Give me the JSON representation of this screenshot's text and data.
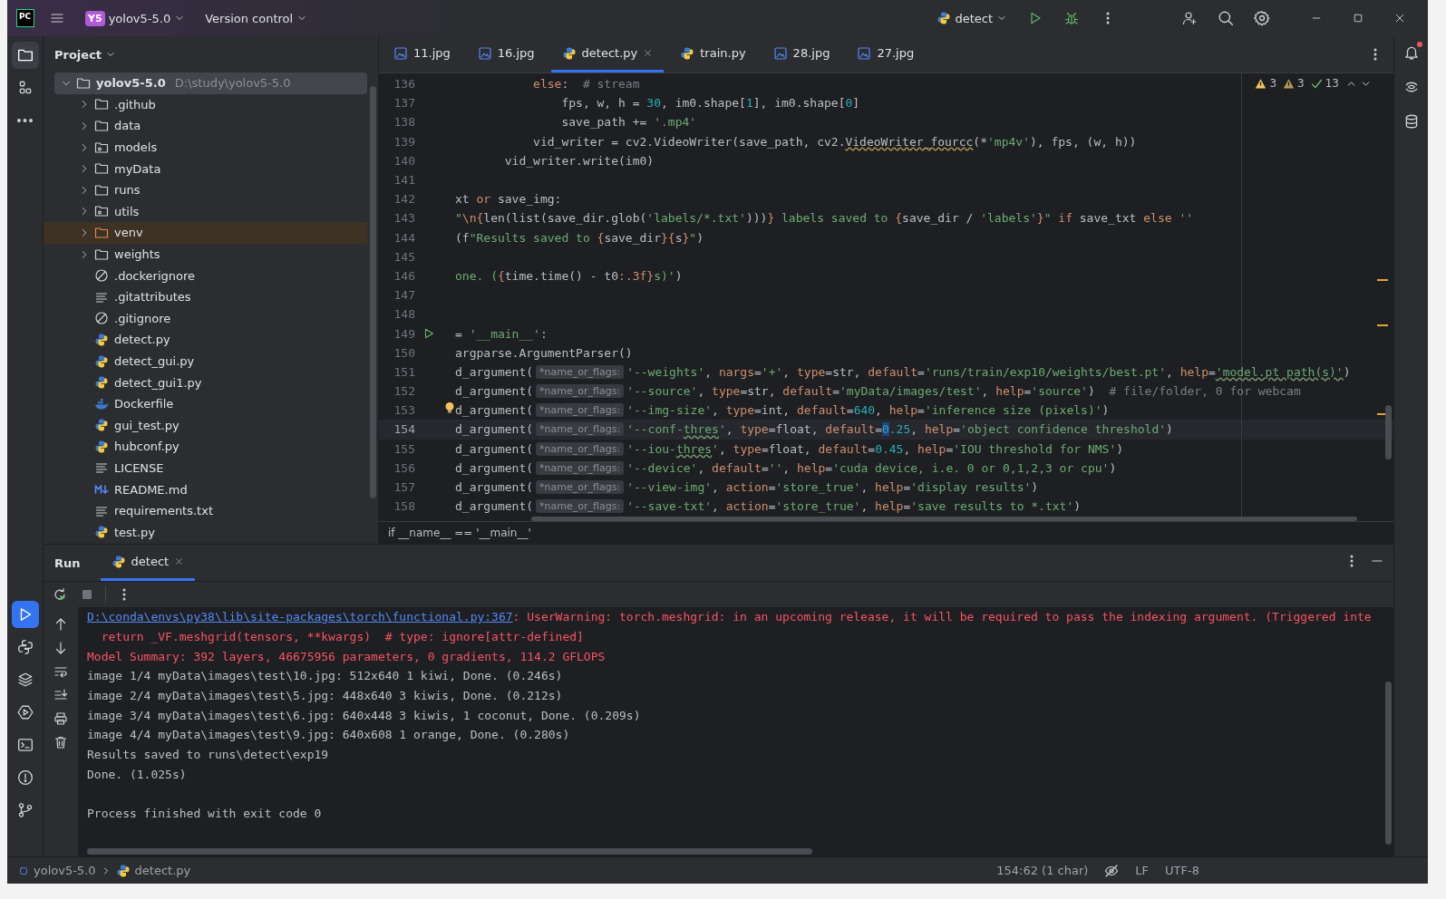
{
  "title_bar": {
    "app_icon": "PC",
    "project_badge": "Y5",
    "project": "yolov5-5.0",
    "vcs": "Version control",
    "run_config": "detect"
  },
  "left_strip": {
    "top": [
      {
        "kind": "project",
        "selected": true
      },
      {
        "kind": "structure",
        "selected": false
      },
      {
        "kind": "more",
        "selected": false
      }
    ],
    "bottom": [
      {
        "kind": "run",
        "selected": true
      },
      {
        "kind": "python-console",
        "selected": false
      },
      {
        "kind": "layers",
        "selected": false
      },
      {
        "kind": "services",
        "selected": false
      },
      {
        "kind": "terminal",
        "selected": false
      },
      {
        "kind": "problems",
        "selected": false
      },
      {
        "kind": "git",
        "selected": false
      }
    ]
  },
  "project_panel": {
    "title": "Project",
    "root": {
      "name": "yolov5-5.0",
      "path": "D:\\study\\yolov5-5.0",
      "expanded": true,
      "selected": true,
      "children": [
        {
          "name": ".github",
          "kind": "folder",
          "expanded": false,
          "excluded": false
        },
        {
          "name": "data",
          "kind": "folder",
          "expanded": false,
          "excluded": false
        },
        {
          "name": "models",
          "kind": "package",
          "expanded": false,
          "excluded": false
        },
        {
          "name": "myData",
          "kind": "folder",
          "expanded": false,
          "excluded": false
        },
        {
          "name": "runs",
          "kind": "folder",
          "expanded": false,
          "excluded": false
        },
        {
          "name": "utils",
          "kind": "package",
          "expanded": false,
          "excluded": false
        },
        {
          "name": "venv",
          "kind": "folder",
          "expanded": false,
          "excluded": true
        },
        {
          "name": "weights",
          "kind": "folder",
          "expanded": false,
          "excluded": false
        },
        {
          "name": ".dockerignore",
          "kind": "ignore",
          "excluded": false
        },
        {
          "name": ".gitattributes",
          "kind": "text",
          "excluded": false
        },
        {
          "name": ".gitignore",
          "kind": "ignore",
          "excluded": false
        },
        {
          "name": "detect.py",
          "kind": "python",
          "excluded": false
        },
        {
          "name": "detect_gui.py",
          "kind": "python",
          "excluded": false
        },
        {
          "name": "detect_gui1.py",
          "kind": "python",
          "excluded": false
        },
        {
          "name": "Dockerfile",
          "kind": "docker",
          "excluded": false
        },
        {
          "name": "gui_test.py",
          "kind": "python",
          "excluded": false
        },
        {
          "name": "hubconf.py",
          "kind": "python",
          "excluded": false
        },
        {
          "name": "LICENSE",
          "kind": "text",
          "excluded": false
        },
        {
          "name": "README.md",
          "kind": "markdown",
          "excluded": false
        },
        {
          "name": "requirements.txt",
          "kind": "text",
          "excluded": false
        },
        {
          "name": "test.py",
          "kind": "python",
          "excluded": false
        }
      ]
    }
  },
  "editor": {
    "tabs": [
      {
        "label": "11.jpg",
        "kind": "image",
        "selected": false,
        "closable": false
      },
      {
        "label": "16.jpg",
        "kind": "image",
        "selected": false,
        "closable": false
      },
      {
        "label": "detect.py",
        "kind": "python",
        "selected": true,
        "closable": true
      },
      {
        "label": "train.py",
        "kind": "python",
        "selected": false,
        "closable": false
      },
      {
        "label": "28.jpg",
        "kind": "image",
        "selected": false,
        "closable": false
      },
      {
        "label": "27.jpg",
        "kind": "image",
        "selected": false,
        "closable": false
      }
    ],
    "inspections": [
      {
        "kind": "warning",
        "count": "3"
      },
      {
        "kind": "weak-warning",
        "count": "3"
      },
      {
        "kind": "ok",
        "count": "13"
      }
    ],
    "lines": [
      {
        "number": "136",
        "current": false,
        "tokens": [
          {
            "t": "           else",
            "kind": "kw"
          },
          {
            "t": ":  ",
            "kind": "plain"
          },
          {
            "t": "# stream",
            "kind": "comment"
          }
        ]
      },
      {
        "number": "137",
        "current": false,
        "tokens": [
          {
            "t": "               fps, w, h = ",
            "kind": "plain"
          },
          {
            "t": "30",
            "kind": "num"
          },
          {
            "t": ", im0.shape[",
            "kind": "plain"
          },
          {
            "t": "1",
            "kind": "num"
          },
          {
            "t": "], im0.shape[",
            "kind": "plain"
          },
          {
            "t": "0",
            "kind": "num"
          },
          {
            "t": "]",
            "kind": "plain"
          }
        ]
      },
      {
        "number": "138",
        "current": false,
        "tokens": [
          {
            "t": "               save_path += ",
            "kind": "plain"
          },
          {
            "t": "'.mp4'",
            "kind": "str"
          }
        ]
      },
      {
        "number": "139",
        "current": false,
        "tokens": [
          {
            "t": "           vid_writer = cv2.VideoWriter(save_path, cv2.",
            "kind": "plain"
          },
          {
            "t": "VideoWriter_fourcc",
            "kind": "warn"
          },
          {
            "t": "(*",
            "kind": "plain"
          },
          {
            "t": "'mp4v'",
            "kind": "str"
          },
          {
            "t": "), fps, (w, h))",
            "kind": "plain"
          }
        ]
      },
      {
        "number": "140",
        "current": false,
        "tokens": [
          {
            "t": "       vid_writer.write(im0)",
            "kind": "plain"
          }
        ]
      },
      {
        "number": "141",
        "current": false
      },
      {
        "number": "142",
        "current": false,
        "tokens": [
          {
            "t": "xt ",
            "kind": "plain"
          },
          {
            "t": "or",
            "kind": "kw"
          },
          {
            "t": " save_img:",
            "kind": "plain"
          }
        ]
      },
      {
        "number": "143",
        "current": false,
        "tokens": [
          {
            "t": "\"",
            "kind": "str"
          },
          {
            "t": "\\n{",
            "kind": "kw"
          },
          {
            "t": "len(list(save_dir.glob(",
            "kind": "plain"
          },
          {
            "t": "'labels/*.txt'",
            "kind": "str"
          },
          {
            "t": ")))",
            "kind": "plain"
          },
          {
            "t": "}",
            "kind": "kw"
          },
          {
            "t": " labels saved to ",
            "kind": "str"
          },
          {
            "t": "{",
            "kind": "kw"
          },
          {
            "t": "save_dir / ",
            "kind": "plain"
          },
          {
            "t": "'labels'",
            "kind": "str"
          },
          {
            "t": "}",
            "kind": "kw"
          },
          {
            "t": "\"",
            "kind": "str"
          },
          {
            "t": " if",
            "kind": "kw"
          },
          {
            "t": " save_txt ",
            "kind": "plain"
          },
          {
            "t": "else",
            "kind": "kw"
          },
          {
            "t": " ''",
            "kind": "str"
          }
        ]
      },
      {
        "number": "144",
        "current": false,
        "tokens": [
          {
            "t": "(f",
            "kind": "plain"
          },
          {
            "t": "\"Results saved to ",
            "kind": "str"
          },
          {
            "t": "{",
            "kind": "kw"
          },
          {
            "t": "save_dir",
            "kind": "plain"
          },
          {
            "t": "}{",
            "kind": "kw"
          },
          {
            "t": "s",
            "kind": "plain"
          },
          {
            "t": "}",
            "kind": "kw"
          },
          {
            "t": "\"",
            "kind": "str"
          },
          {
            "t": ")",
            "kind": "plain"
          }
        ]
      },
      {
        "number": "145",
        "current": false
      },
      {
        "number": "146",
        "current": false,
        "tokens": [
          {
            "t": "one. (",
            "kind": "str"
          },
          {
            "t": "{",
            "kind": "kw"
          },
          {
            "t": "time.time() - t0",
            "kind": "plain"
          },
          {
            "t": ":.3f",
            "kind": "kw"
          },
          {
            "t": "}",
            "kind": "kw"
          },
          {
            "t": "s)'",
            "kind": "str"
          },
          {
            "t": ")",
            "kind": "plain"
          }
        ]
      },
      {
        "number": "147",
        "current": false
      },
      {
        "number": "148",
        "current": false
      },
      {
        "number": "149",
        "current": false,
        "marker": {
          "kind": "run"
        },
        "tokens": [
          {
            "t": "= ",
            "kind": "plain"
          },
          {
            "t": "'__main__'",
            "kind": "str"
          },
          {
            "t": ":",
            "kind": "plain"
          }
        ]
      },
      {
        "number": "150",
        "current": false,
        "tokens": [
          {
            "t": "argparse.ArgumentParser()",
            "kind": "plain"
          }
        ]
      },
      {
        "number": "151",
        "current": false,
        "tokens": [
          {
            "t": "d_argument(",
            "kind": "plain"
          },
          {
            "t": "*name_or_flags:",
            "kind": "hint"
          },
          {
            "t": "'--weights'",
            "kind": "str"
          },
          {
            "t": ", ",
            "kind": "plain"
          },
          {
            "t": "nargs",
            "kind": "kw"
          },
          {
            "t": "=",
            "kind": "plain"
          },
          {
            "t": "'+'",
            "kind": "str"
          },
          {
            "t": ", ",
            "kind": "plain"
          },
          {
            "t": "type",
            "kind": "kw"
          },
          {
            "t": "=str, ",
            "kind": "plain"
          },
          {
            "t": "default",
            "kind": "kw"
          },
          {
            "t": "=",
            "kind": "plain"
          },
          {
            "t": "'runs/train/exp10/weights/best.pt'",
            "kind": "str"
          },
          {
            "t": ", ",
            "kind": "plain"
          },
          {
            "t": "help",
            "kind": "kw"
          },
          {
            "t": "=",
            "kind": "plain"
          },
          {
            "t": "'model.pt path(s)'",
            "kind": "typo"
          },
          {
            "t": ")",
            "kind": "plain"
          }
        ]
      },
      {
        "number": "152",
        "current": false,
        "tokens": [
          {
            "t": "d_argument(",
            "kind": "plain"
          },
          {
            "t": "*name_or_flags:",
            "kind": "hint"
          },
          {
            "t": "'--source'",
            "kind": "str"
          },
          {
            "t": ", ",
            "kind": "plain"
          },
          {
            "t": "type",
            "kind": "kw"
          },
          {
            "t": "=str, ",
            "kind": "plain"
          },
          {
            "t": "default",
            "kind": "kw"
          },
          {
            "t": "=",
            "kind": "plain"
          },
          {
            "t": "'myData/images/test'",
            "kind": "str"
          },
          {
            "t": ", ",
            "kind": "plain"
          },
          {
            "t": "help",
            "kind": "kw"
          },
          {
            "t": "=",
            "kind": "plain"
          },
          {
            "t": "'source'",
            "kind": "str"
          },
          {
            "t": ")  ",
            "kind": "plain"
          },
          {
            "t": "# file/folder, 0 for webcam",
            "kind": "comment"
          }
        ]
      },
      {
        "number": "153",
        "current": false,
        "marker": {
          "kind": "bulb"
        },
        "tokens": [
          {
            "t": "d_argument(",
            "kind": "plain"
          },
          {
            "t": "*name_or_flags:",
            "kind": "hint"
          },
          {
            "t": "'--img-size'",
            "kind": "str"
          },
          {
            "t": ", ",
            "kind": "plain"
          },
          {
            "t": "type",
            "kind": "kw"
          },
          {
            "t": "=int, ",
            "kind": "plain"
          },
          {
            "t": "default",
            "kind": "kw"
          },
          {
            "t": "=",
            "kind": "plain"
          },
          {
            "t": "640",
            "kind": "num"
          },
          {
            "t": ", ",
            "kind": "plain"
          },
          {
            "t": "help",
            "kind": "kw"
          },
          {
            "t": "=",
            "kind": "plain"
          },
          {
            "t": "'inference size (pixels)'",
            "kind": "str"
          },
          {
            "t": ")",
            "kind": "plain"
          }
        ]
      },
      {
        "number": "154",
        "current": true,
        "tokens": [
          {
            "t": "d_argument(",
            "kind": "plain"
          },
          {
            "t": "*name_or_flags:",
            "kind": "hint"
          },
          {
            "t": "'--conf-",
            "kind": "str"
          },
          {
            "t": "thres",
            "kind": "typo"
          },
          {
            "t": "'",
            "kind": "str"
          },
          {
            "t": ", ",
            "kind": "plain"
          },
          {
            "t": "type",
            "kind": "kw"
          },
          {
            "t": "=float, ",
            "kind": "plain"
          },
          {
            "t": "default",
            "kind": "kw"
          },
          {
            "t": "=",
            "kind": "plain"
          },
          {
            "t": "0",
            "kind": "sel"
          },
          {
            "t": ".25",
            "kind": "num"
          },
          {
            "t": ", ",
            "kind": "plain"
          },
          {
            "t": "help",
            "kind": "kw"
          },
          {
            "t": "=",
            "kind": "plain"
          },
          {
            "t": "'object confidence threshold'",
            "kind": "str"
          },
          {
            "t": ")",
            "kind": "plain"
          }
        ]
      },
      {
        "number": "155",
        "current": false,
        "tokens": [
          {
            "t": "d_argument(",
            "kind": "plain"
          },
          {
            "t": "*name_or_flags:",
            "kind": "hint"
          },
          {
            "t": "'--iou-",
            "kind": "str"
          },
          {
            "t": "thres",
            "kind": "typo"
          },
          {
            "t": "'",
            "kind": "str"
          },
          {
            "t": ", ",
            "kind": "plain"
          },
          {
            "t": "type",
            "kind": "kw"
          },
          {
            "t": "=float, ",
            "kind": "plain"
          },
          {
            "t": "default",
            "kind": "kw"
          },
          {
            "t": "=",
            "kind": "plain"
          },
          {
            "t": "0.45",
            "kind": "num"
          },
          {
            "t": ", ",
            "kind": "plain"
          },
          {
            "t": "help",
            "kind": "kw"
          },
          {
            "t": "=",
            "kind": "plain"
          },
          {
            "t": "'IOU threshold for NMS'",
            "kind": "str"
          },
          {
            "t": ")",
            "kind": "plain"
          }
        ]
      },
      {
        "number": "156",
        "current": false,
        "tokens": [
          {
            "t": "d_argument(",
            "kind": "plain"
          },
          {
            "t": "*name_or_flags:",
            "kind": "hint"
          },
          {
            "t": "'--device'",
            "kind": "str"
          },
          {
            "t": ", ",
            "kind": "plain"
          },
          {
            "t": "default",
            "kind": "kw"
          },
          {
            "t": "=",
            "kind": "plain"
          },
          {
            "t": "''",
            "kind": "str"
          },
          {
            "t": ", ",
            "kind": "plain"
          },
          {
            "t": "help",
            "kind": "kw"
          },
          {
            "t": "=",
            "kind": "plain"
          },
          {
            "t": "'cuda device, i.e. 0 or 0,1,2,3 or cpu'",
            "kind": "str"
          },
          {
            "t": ")",
            "kind": "plain"
          }
        ]
      },
      {
        "number": "157",
        "current": false,
        "tokens": [
          {
            "t": "d_argument(",
            "kind": "plain"
          },
          {
            "t": "*name_or_flags:",
            "kind": "hint"
          },
          {
            "t": "'--view-img'",
            "kind": "str"
          },
          {
            "t": ", ",
            "kind": "plain"
          },
          {
            "t": "action",
            "kind": "kw"
          },
          {
            "t": "=",
            "kind": "plain"
          },
          {
            "t": "'store_true'",
            "kind": "str"
          },
          {
            "t": ", ",
            "kind": "plain"
          },
          {
            "t": "help",
            "kind": "kw"
          },
          {
            "t": "=",
            "kind": "plain"
          },
          {
            "t": "'display results'",
            "kind": "str"
          },
          {
            "t": ")",
            "kind": "plain"
          }
        ]
      },
      {
        "number": "158",
        "current": false,
        "tokens": [
          {
            "t": "d_argument(",
            "kind": "plain"
          },
          {
            "t": "*name_or_flags:",
            "kind": "hint"
          },
          {
            "t": "'--save-txt'",
            "kind": "str"
          },
          {
            "t": ", ",
            "kind": "plain"
          },
          {
            "t": "action",
            "kind": "kw"
          },
          {
            "t": "=",
            "kind": "plain"
          },
          {
            "t": "'store_true'",
            "kind": "str"
          },
          {
            "t": ", ",
            "kind": "plain"
          },
          {
            "t": "help",
            "kind": "kw"
          },
          {
            "t": "=",
            "kind": "plain"
          },
          {
            "t": "'save results to *.txt'",
            "kind": "str"
          },
          {
            "t": ")",
            "kind": "plain"
          }
        ]
      }
    ],
    "breadcrumb": "if __name__ == '__main__'"
  },
  "run_panel": {
    "title": "Run",
    "tabs": [
      {
        "label": "detect",
        "selected": true
      }
    ],
    "lines": [
      {
        "segments": [
          {
            "t": "D:\\conda\\envs\\py38\\lib\\site-packages\\torch\\functional.py:367",
            "kind": "link"
          },
          {
            "t": ": UserWarning: torch.meshgrid: in an upcoming release, it will be required to pass the indexing argument. (Triggered inte",
            "kind": "err"
          }
        ]
      },
      {
        "segments": [
          {
            "t": "  return _VF.meshgrid(tensors, **kwargs)  # type: ignore[attr-defined]",
            "kind": "err"
          }
        ]
      },
      {
        "segments": [
          {
            "t": "Model Summary: 392 layers, 46675956 parameters, 0 gradients, 114.2 GFLOPS",
            "kind": "err"
          }
        ]
      },
      {
        "segments": [
          {
            "t": "image 1/4 myData\\images\\test\\10.jpg: 512x640 1 kiwi, Done. (0.246s)",
            "kind": "out"
          }
        ]
      },
      {
        "segments": [
          {
            "t": "image 2/4 myData\\images\\test\\5.jpg: 448x640 3 kiwis, Done. (0.212s)",
            "kind": "out"
          }
        ]
      },
      {
        "segments": [
          {
            "t": "image 3/4 myData\\images\\test\\6.jpg: 640x448 3 kiwis, 1 coconut, Done. (0.209s)",
            "kind": "out"
          }
        ]
      },
      {
        "segments": [
          {
            "t": "image 4/4 myData\\images\\test\\9.jpg: 640x608 1 orange, Done. (0.280s)",
            "kind": "out"
          }
        ]
      },
      {
        "segments": [
          {
            "t": "Results saved to runs\\detect\\exp19",
            "kind": "out"
          }
        ]
      },
      {
        "segments": [
          {
            "t": "Done. (1.025s)",
            "kind": "out"
          }
        ]
      },
      {
        "kind": "blank"
      },
      {
        "segments": [
          {
            "t": "Process finished with exit code 0",
            "kind": "out"
          }
        ]
      }
    ]
  },
  "status_bar": {
    "breadcrumbs": [
      {
        "label": "yolov5-5.0",
        "kind": "module"
      },
      {
        "label": "detect.py",
        "kind": "python"
      }
    ],
    "position": "154:62 (1 char)",
    "line_separator": "LF",
    "encoding": "UTF-8"
  }
}
